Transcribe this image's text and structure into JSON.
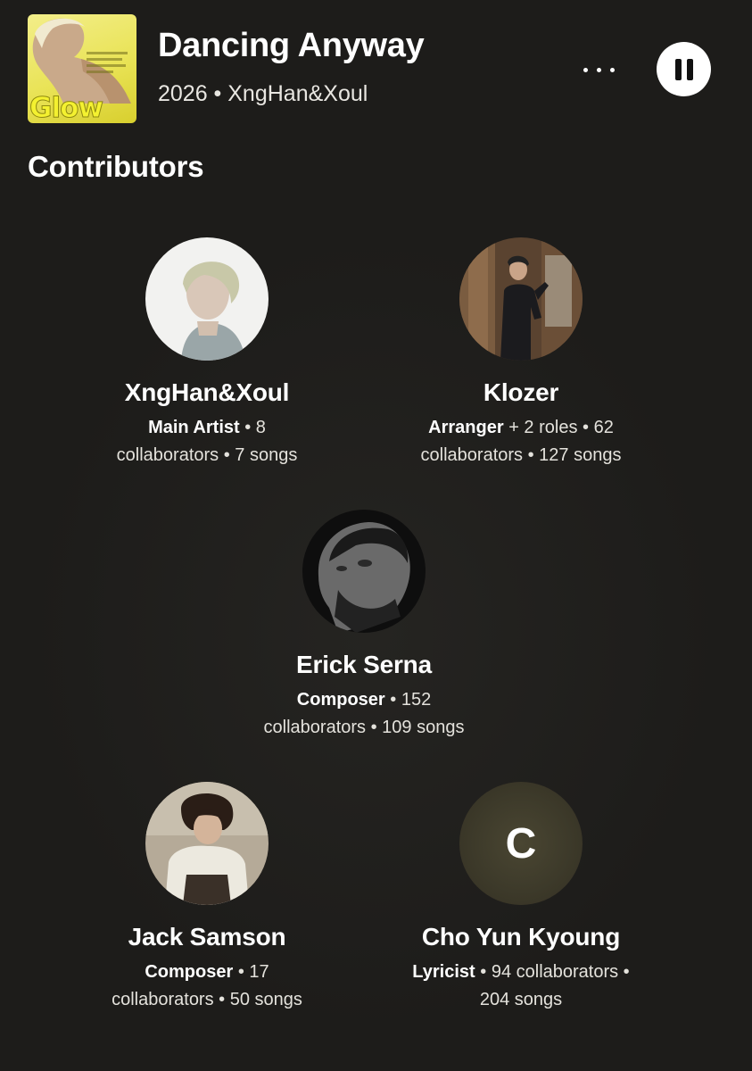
{
  "header": {
    "cover_text": "Glow",
    "title": "Dancing Anyway",
    "meta": "2026 • XngHan&Xoul",
    "more_icon": "more-horizontal-icon",
    "pause_icon": "pause-icon"
  },
  "section_title": "Contributors",
  "contributors": [
    {
      "name": "XngHan&Xoul",
      "role": "Main Artist",
      "line1_rest": " • 8",
      "line2": "collaborators • 7 songs",
      "avatar": "photo"
    },
    {
      "name": "Klozer",
      "role": "Arranger",
      "line1_rest": " + 2 roles • 62",
      "line2": "collaborators • 127 songs",
      "avatar": "photo"
    },
    {
      "name": "Erick Serna",
      "role": "Composer",
      "line1_rest": " • 152",
      "line2": "collaborators • 109 songs",
      "avatar": "photo"
    },
    {
      "name": "Jack Samson",
      "role": "Composer",
      "line1_rest": " • 17",
      "line2": "collaborators • 50 songs",
      "avatar": "photo"
    },
    {
      "name": "Cho Yun Kyoung",
      "role": "Lyricist",
      "line1_rest": " • 94 collaborators •",
      "line2": "204 songs",
      "avatar_letter": "C"
    }
  ],
  "colors": {
    "background": "#1d1c1a",
    "text": "#ffffff",
    "secondary_text": "#e4e2dc",
    "cover_yellow": "#e9e356",
    "letter_avatar": "#3d3a2a"
  }
}
